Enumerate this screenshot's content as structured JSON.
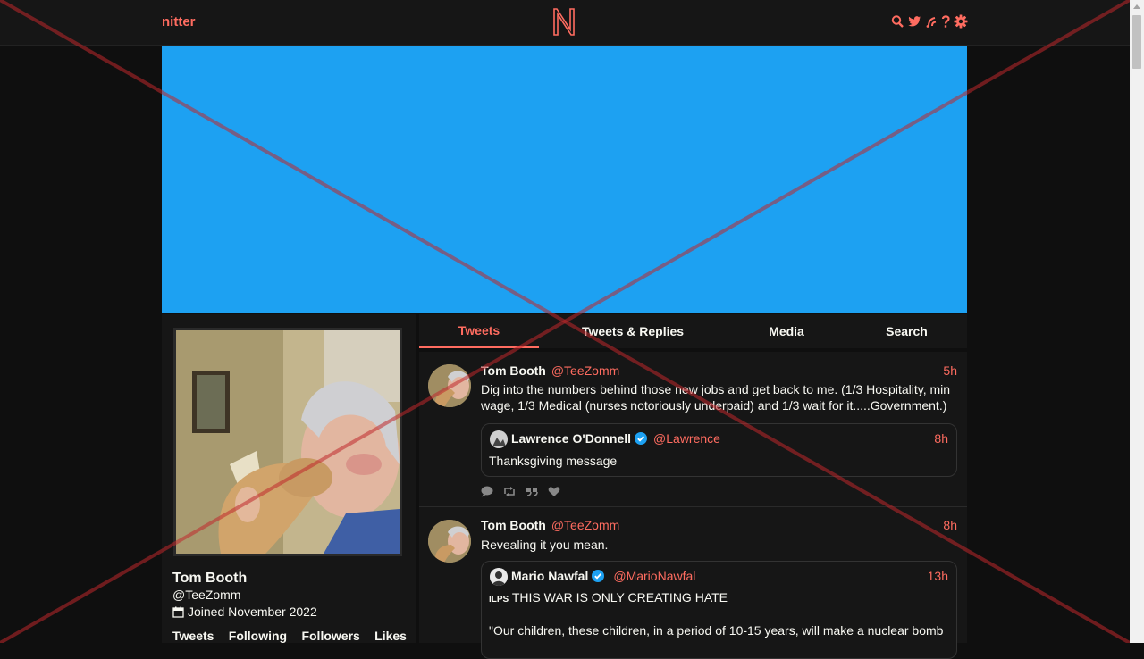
{
  "nav": {
    "brand": "nitter",
    "logo_letter": "N",
    "icons": [
      "search-icon",
      "twitter-bird-icon",
      "rss-icon",
      "help-icon",
      "settings-gear-icon"
    ]
  },
  "colors": {
    "accent": "#ff6c60",
    "banner": "#1da1f2",
    "background": "#0f0f0f",
    "panel": "#161616",
    "verified": "#1da1f2"
  },
  "profile": {
    "name": "Tom Booth",
    "handle": "@TeeZomm",
    "joined": "Joined November 2022",
    "stats": [
      "Tweets",
      "Following",
      "Followers",
      "Likes"
    ]
  },
  "tabs": [
    {
      "label": "Tweets",
      "active": true
    },
    {
      "label": "Tweets & Replies",
      "active": false
    },
    {
      "label": "Media",
      "active": false
    },
    {
      "label": "Search",
      "active": false
    }
  ],
  "tweets": [
    {
      "fullname": "Tom Booth",
      "username": "@TeeZomm",
      "date": "5h",
      "text": "Dig  into the numbers behind those new jobs and get back to me. (1/3 Hospitality, min wage, 1/3 Medical (nurses notoriously underpaid) and 1/3 wait for it.....Government.)",
      "quote": {
        "fullname": "Lawrence O'Donnell",
        "username": "@Lawrence",
        "date": "8h",
        "text": "Thanksgiving message"
      }
    },
    {
      "fullname": "Tom Booth",
      "username": "@TeeZomm",
      "date": "8h",
      "text": "Revealing it you mean.",
      "quote": {
        "fullname": "Mario Nawfal",
        "username": "@MarioNawfal",
        "date": "13h",
        "prefix": "ILPS",
        "text": "THIS WAR IS ONLY CREATING HATE",
        "text2": "\"Our children, these children, in a period of 10-15 years, will make a nuclear bomb"
      }
    }
  ]
}
